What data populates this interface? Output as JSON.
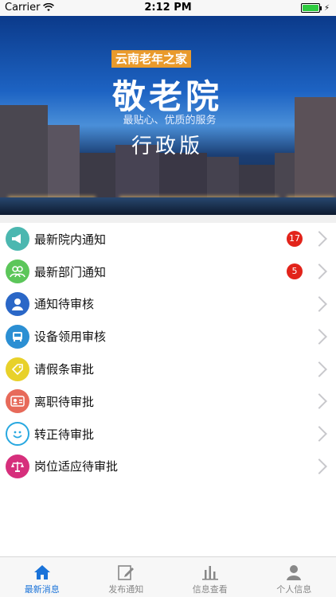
{
  "status_bar": {
    "carrier": "Carrier",
    "time": "2:12 PM"
  },
  "banner": {
    "tag": "云南老年之家",
    "title": "敬老院",
    "slogan": "最贴心、优质的服务",
    "edition": "行政版"
  },
  "menu": {
    "items": [
      {
        "label": "最新院内通知",
        "badge": "17",
        "icon": "megaphone-icon",
        "color": "#4bb7b0"
      },
      {
        "label": "最新部门通知",
        "badge": "5",
        "icon": "group-icon",
        "color": "#5cc65a"
      },
      {
        "label": "通知待审核",
        "badge": "",
        "icon": "user-icon",
        "color": "#2a67c7"
      },
      {
        "label": "设备领用审核",
        "badge": "",
        "icon": "bus-icon",
        "color": "#2b8fd3"
      },
      {
        "label": "请假条审批",
        "badge": "",
        "icon": "tag-icon",
        "color": "#e8d12a"
      },
      {
        "label": "离职待审批",
        "badge": "",
        "icon": "id-card-icon",
        "color": "#e76a5a"
      },
      {
        "label": "转正待审批",
        "badge": "",
        "icon": "smile-icon",
        "color": "#ffffff"
      },
      {
        "label": "岗位适应待审批",
        "badge": "",
        "icon": "scale-icon",
        "color": "#d62f7c"
      }
    ]
  },
  "tabbar": {
    "tabs": [
      {
        "label": "最新消息",
        "icon": "home-icon",
        "active": true
      },
      {
        "label": "发布通知",
        "icon": "edit-icon",
        "active": false
      },
      {
        "label": "信息查看",
        "icon": "bar-chart-icon",
        "active": false
      },
      {
        "label": "个人信息",
        "icon": "person-icon",
        "active": false
      }
    ]
  },
  "colors": {
    "accent": "#1a73d9",
    "badge": "#e2231a",
    "tag": "#e99a2b"
  }
}
